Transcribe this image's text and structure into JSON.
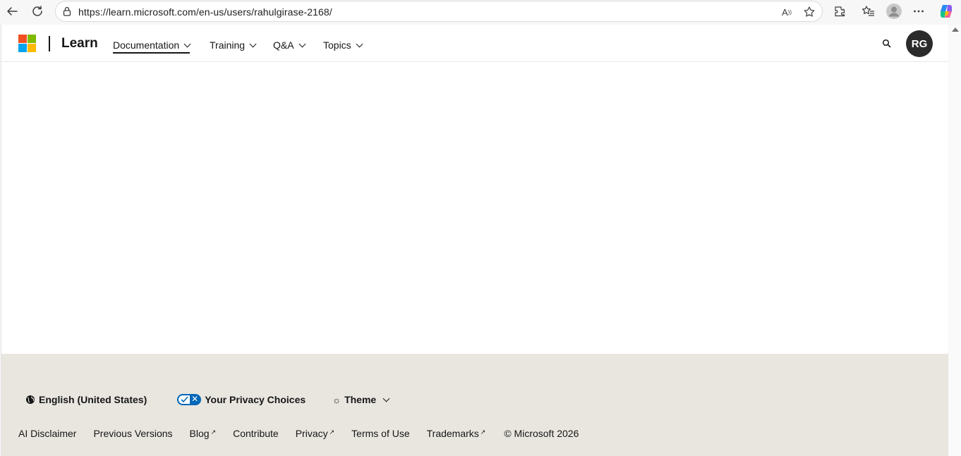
{
  "browser": {
    "url": "https://learn.microsoft.com/en-us/users/rahulgirase-2168/"
  },
  "header": {
    "brand": "Learn",
    "nav": [
      {
        "label": "Documentation"
      },
      {
        "label": "Training"
      },
      {
        "label": "Q&A"
      },
      {
        "label": "Topics"
      }
    ],
    "avatar_initials": "RG",
    "logo_colors": [
      "#f25022",
      "#7fba00",
      "#00a4ef",
      "#ffb900"
    ]
  },
  "footer": {
    "language": "English (United States)",
    "privacy": "Your Privacy Choices",
    "theme": "Theme",
    "links": [
      {
        "label": "AI Disclaimer"
      },
      {
        "label": "Previous Versions"
      },
      {
        "label": "Blog"
      },
      {
        "label": "Contribute"
      },
      {
        "label": "Privacy"
      },
      {
        "label": "Terms of Use"
      },
      {
        "label": "Trademarks"
      }
    ],
    "copyright": "© Microsoft 2026",
    "background": "#e8e6df"
  }
}
